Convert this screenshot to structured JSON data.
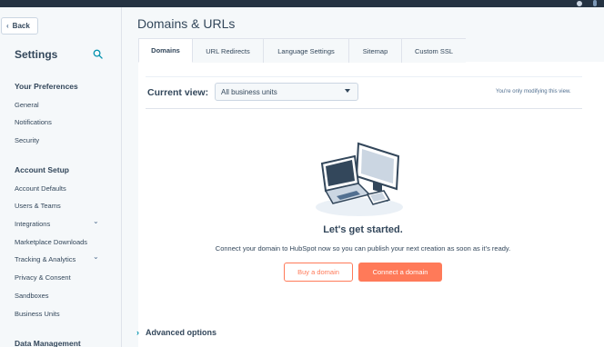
{
  "topbar": {},
  "sidebar": {
    "back_label": "Back",
    "title": "Settings",
    "sections": [
      {
        "label": "Your Preferences",
        "items": [
          {
            "label": "General"
          },
          {
            "label": "Notifications"
          },
          {
            "label": "Security"
          }
        ]
      },
      {
        "label": "Account Setup",
        "items": [
          {
            "label": "Account Defaults"
          },
          {
            "label": "Users & Teams"
          },
          {
            "label": "Integrations"
          },
          {
            "label": "Marketplace Downloads"
          },
          {
            "label": "Tracking & Analytics"
          },
          {
            "label": "Privacy & Consent"
          },
          {
            "label": "Sandboxes"
          },
          {
            "label": "Business Units"
          }
        ]
      },
      {
        "label": "Data Management",
        "items": []
      }
    ]
  },
  "main": {
    "title": "Domains & URLs",
    "tabs": [
      {
        "label": "Domains",
        "active": true
      },
      {
        "label": "URL Redirects"
      },
      {
        "label": "Language Settings"
      },
      {
        "label": "Sitemap"
      },
      {
        "label": "Custom SSL"
      }
    ],
    "current_view": {
      "label": "Current view:",
      "selected": "All business units",
      "note": "You're only modifying this view."
    },
    "empty_state": {
      "heading": "Let's get started.",
      "text": "Connect your domain to HubSpot now so you can publish your next creation as soon as it's ready.",
      "buy_label": "Buy a domain",
      "connect_label": "Connect a domain"
    },
    "advanced_label": "Advanced options"
  },
  "colors": {
    "accent": "#ff7a59",
    "text": "#33475b",
    "sidebar_bg": "#f5f8fa",
    "topbar": "#253342"
  }
}
